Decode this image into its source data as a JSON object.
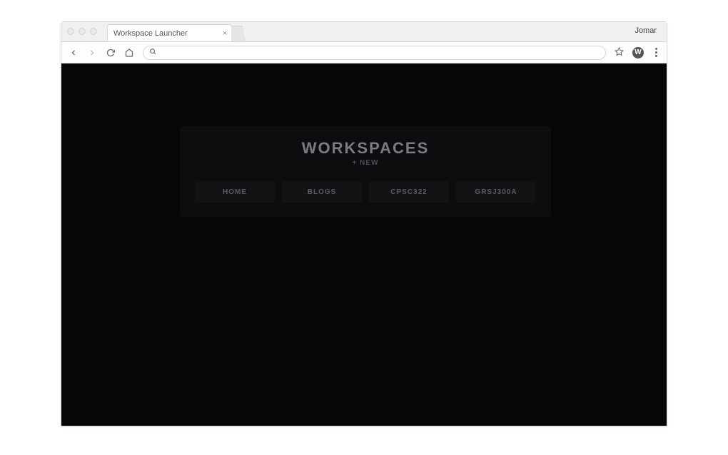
{
  "browser": {
    "tab_title": "Workspace Launcher",
    "close_glyph": "×",
    "profile_name": "Jomar",
    "ext_letter": "W",
    "address_value": ""
  },
  "panel": {
    "title": "WORKSPACES",
    "new_label": "+ NEW"
  },
  "workspaces": [
    {
      "label": "HOME"
    },
    {
      "label": "BLOGS"
    },
    {
      "label": "CPSC322"
    },
    {
      "label": "GRSJ300A"
    }
  ]
}
